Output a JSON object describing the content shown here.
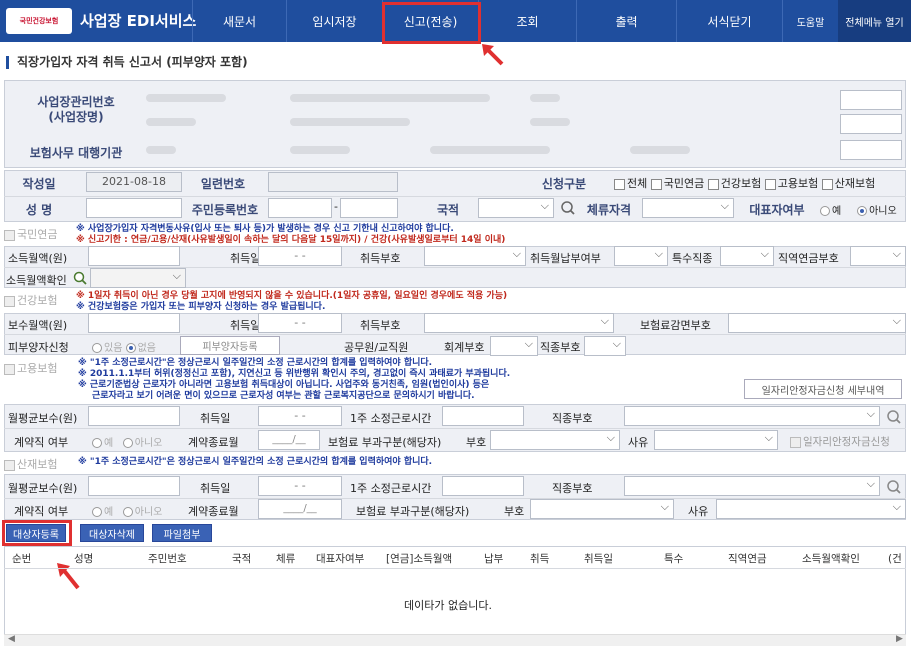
{
  "header": {
    "logo_text": "국민건강보험",
    "title": "사업장 EDI서비스",
    "menus": [
      "새문서",
      "임시저장",
      "신고(전송)",
      "조회",
      "출력",
      "서식닫기"
    ],
    "help": "도움말",
    "all_menu": "전체메뉴 열기"
  },
  "page_title": "직장가입자 자격 취득 신고서 (피부양자 포함)",
  "employer": {
    "reg_label": "사업장관리번호\n(사업장명)",
    "agency_label": "보험사무 대행기관"
  },
  "form": {
    "date_label": "작성일",
    "date_value": "2021-08-18",
    "serial_label": "일련번호",
    "req_label": "신청구분",
    "req_options": [
      "전체",
      "국민연금",
      "건강보험",
      "고용보험",
      "산재보험"
    ],
    "name_label": "성 명",
    "rrn_label": "주민등록번호",
    "nation_label": "국적",
    "stay_label": "체류자격",
    "rep_label": "대표자여부",
    "yes": "예",
    "no": "아니오"
  },
  "pension": {
    "title": "국민연금",
    "note1": "※ 사업장가입자 자격변동사유(입사 또는 퇴사 등)가 발생하는 경우 신고 기한내 신고하여야 합니다.",
    "note2": "※ 신고기한 : 연금/고용/산재(사유발생일이 속하는 달의 다음달 15일까지) / 건강(사유발생일로부터 14일 이내)",
    "income": "소득월액(원)",
    "acq_date": "취득일",
    "acq_code": "취득부호",
    "pay_flag": "취득월납부여부",
    "special": "특수직종",
    "occ_code": "직역연금부호",
    "income_check": "소득월액확인",
    "date_ph": "- -"
  },
  "health": {
    "title": "건강보험",
    "note1": "※ 1일자 취득이 아닌 경우 당월 고지에 반영되지 않을 수 있습니다.(1일자 공휴일, 일요일인 경우에도 적용 가능)",
    "note2": "※ 건강보험증은 가입자 또는 피부양자 신청하는 경우 발급됩니다.",
    "wage": "보수월액(원)",
    "acq_date": "취득일",
    "acq_code": "취득부호",
    "reduce": "보험료감면부호",
    "dep_apply": "피부양자신청",
    "have": "있음",
    "none": "없음",
    "dep_reg": "피부양자등록",
    "civil": "공무원/교직원",
    "account": "회계부호",
    "job": "직종부호"
  },
  "employment": {
    "title": "고용보험",
    "note1": "※ \"1주 소정근로시간\"은 정상근로시 일주일간의 소정 근로시간의 합계를 입력하여야 합니다.",
    "note2": "※ 2011.1.1부터 허위(정정신고 포함), 지연신고 등 위반행위 확인시 주의, 경고없이 즉시 과태료가 부과됩니다.",
    "note3": "※ 근로기준법상 근로자가 아니라면 고용보험 취득대상이 아닙니다. 사업주와 동거친족, 임원(법인이사) 등은",
    "note4": "근로자라고 보기 어려운 면이 있으므로 근로자성 여부는 관할 근로복지공단으로 문의하시기 바랍니다.",
    "job_support": "일자리안정자금신청 세부내역",
    "avg_wage": "월평균보수(원)",
    "acq_date": "취득일",
    "hours": "1주 소정근로시간",
    "job_code": "직종부호",
    "contract": "계약직 여부",
    "yes": "예",
    "no": "아니오",
    "end_month": "계약종료월",
    "month_ph": "____/__",
    "levy": "보험료 부과구분(해당자)",
    "code": "부호",
    "reason": "사유",
    "job_support2": "일자리안정자금신청"
  },
  "accident": {
    "title": "산재보험",
    "note1": "※ \"1주 소정근로시간\"은 정상근로시 일주일간의 소정 근로시간의 합계를 입력하여야 합니다.",
    "avg_wage": "월평균보수(원)",
    "acq_date": "취득일",
    "hours": "1주 소정근로시간",
    "job_code": "직종부호",
    "contract": "계약직 여부",
    "yes": "예",
    "no": "아니오",
    "end_month": "계약종료월",
    "month_ph": "____/__",
    "levy": "보험료 부과구분(해당자)",
    "code": "부호",
    "reason": "사유"
  },
  "actions": {
    "register": "대상자등록",
    "delete": "대상자삭제",
    "attach": "파일첨부"
  },
  "table": {
    "columns": [
      "순번",
      "성명",
      "주민번호",
      "국적",
      "체류",
      "대표자여부",
      "[연금]소득월액",
      "납부",
      "취득",
      "취득일",
      "특수",
      "직역연금",
      "소득월액확인",
      "(건"
    ],
    "empty": "데이타가 없습니다."
  },
  "colors": {
    "header": "#1f4e9e",
    "highlight": "#e03030",
    "note_blue": "#1f3b9e",
    "note_red": "#c0281c"
  }
}
